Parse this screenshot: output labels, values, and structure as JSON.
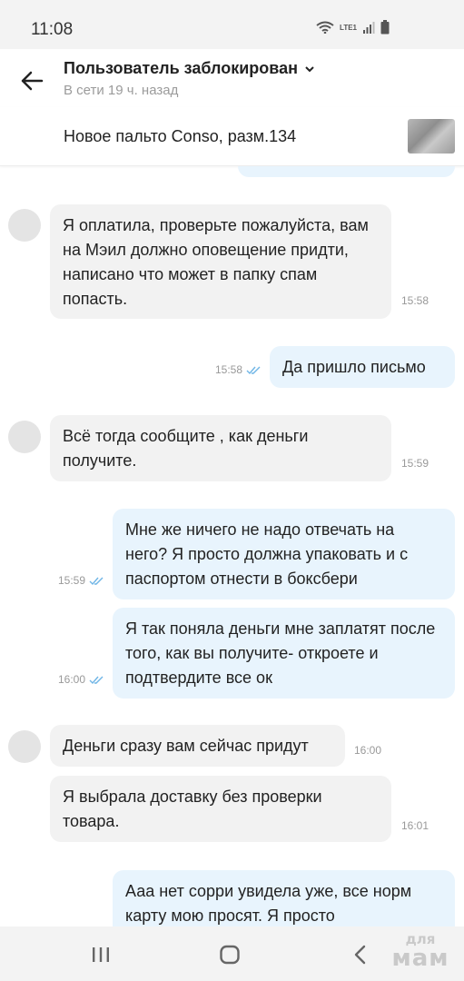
{
  "status_bar": {
    "time": "11:08",
    "network": "LTE1"
  },
  "header": {
    "title": "Пользователь заблокирован",
    "subtitle": "В сети 19 ч. назад"
  },
  "product": {
    "title": "Новое пальто Conso, разм.134"
  },
  "messages": [
    {
      "direction": "in",
      "text": "Я оплатила, проверьте пожалуйста, вам на Мэил должно оповещение придти, написано что может в папку спам попасть.",
      "time": "15:58"
    },
    {
      "direction": "out",
      "text": "Да пришло письмо",
      "time": "15:58",
      "read": true
    },
    {
      "direction": "in",
      "text": "Всё тогда сообщите , как деньги получите.",
      "time": "15:59"
    },
    {
      "direction": "out",
      "text": "Мне же ничего не надо отвечать на него? Я просто должна упаковать и с паспортом отнести в боксбери",
      "time": "15:59",
      "read": true
    },
    {
      "direction": "out",
      "text": "Я так поняла деньги мне заплатят после того, как вы получите- откроете и подтвердите все ок",
      "time": "16:00",
      "read": true
    },
    {
      "direction": "in",
      "text": "Деньги сразу вам сейчас придут",
      "time": "16:00"
    },
    {
      "direction": "in",
      "text": "Я выбрала доставку без проверки товара.",
      "time": "16:01"
    },
    {
      "direction": "out",
      "text": "Ааа нет сорри увидела уже, все норм карту мою просят. Я просто",
      "time": ""
    }
  ],
  "watermark": {
    "line1": "для",
    "line2": "мам"
  },
  "colors": {
    "outgoing_bubble": "#e8f4fd",
    "incoming_bubble": "#f2f2f2",
    "read_check": "#6fb5e6"
  }
}
